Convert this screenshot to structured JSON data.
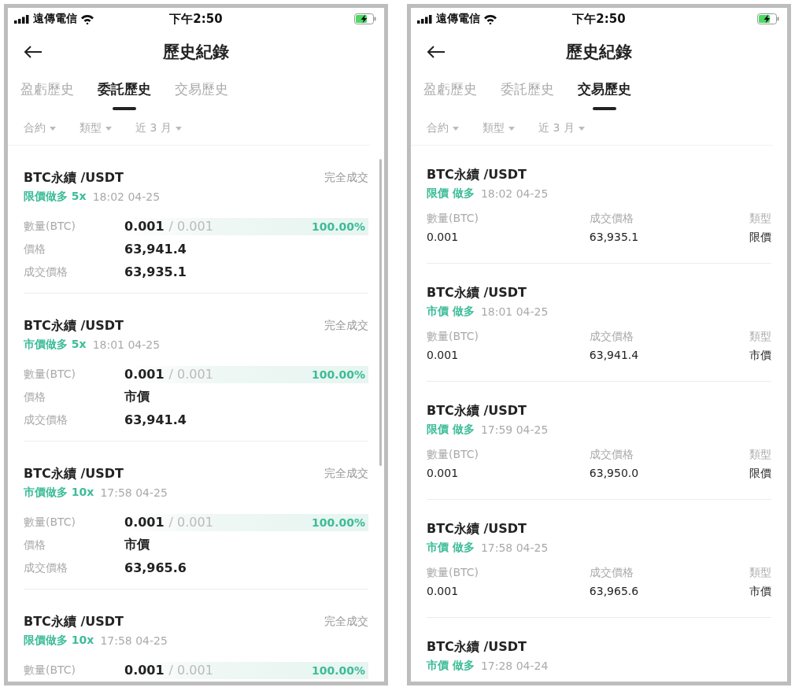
{
  "screens": [
    {
      "status_bar": {
        "carrier": "遠傳電信",
        "time": "下午2:50"
      },
      "title": "歷史紀錄",
      "tabs": [
        {
          "label": "盈虧歷史",
          "selected": false
        },
        {
          "label": "委託歷史",
          "selected": true
        },
        {
          "label": "交易歷史",
          "selected": false
        }
      ],
      "filters": [
        "合約",
        "類型",
        "近 3 月"
      ],
      "cards": [
        {
          "kind": "order",
          "pair": "BTC永續 /USDT",
          "status": "完全成交",
          "side": "限價做多 5x",
          "time": "18:02 04-25",
          "quantity": {
            "label": "數量(BTC)",
            "filled": "0.001",
            "total": "/ 0.001",
            "percent": "100.00%"
          },
          "fields": [
            {
              "label": "價格",
              "value": "63,941.4"
            },
            {
              "label": "成交價格",
              "value": "63,935.1"
            }
          ]
        },
        {
          "kind": "order",
          "pair": "BTC永續 /USDT",
          "status": "完全成交",
          "side": "市價做多 5x",
          "time": "18:01 04-25",
          "quantity": {
            "label": "數量(BTC)",
            "filled": "0.001",
            "total": "/ 0.001",
            "percent": "100.00%"
          },
          "fields": [
            {
              "label": "價格",
              "value": "市價"
            },
            {
              "label": "成交價格",
              "value": "63,941.4"
            }
          ]
        },
        {
          "kind": "order",
          "pair": "BTC永續 /USDT",
          "status": "完全成交",
          "side": "市價做多 10x",
          "time": "17:58 04-25",
          "quantity": {
            "label": "數量(BTC)",
            "filled": "0.001",
            "total": "/ 0.001",
            "percent": "100.00%"
          },
          "fields": [
            {
              "label": "價格",
              "value": "市價"
            },
            {
              "label": "成交價格",
              "value": "63,965.6"
            }
          ]
        },
        {
          "kind": "order",
          "pair": "BTC永續 /USDT",
          "status": "完全成交",
          "side": "限價做多 10x",
          "time": "17:58 04-25",
          "quantity": {
            "label": "數量(BTC)",
            "filled": "0.001",
            "total": "/ 0.001",
            "percent": "100.00%"
          }
        }
      ]
    },
    {
      "status_bar": {
        "carrier": "遠傳電信",
        "time": "下午2:50"
      },
      "title": "歷史紀錄",
      "tabs": [
        {
          "label": "盈虧歷史",
          "selected": false
        },
        {
          "label": "委託歷史",
          "selected": false
        },
        {
          "label": "交易歷史",
          "selected": true
        }
      ],
      "filters": [
        "合約",
        "類型",
        "近 3 月"
      ],
      "cards": [
        {
          "kind": "trade",
          "pair": "BTC永續 /USDT",
          "side": "限價 做多",
          "time": "18:02 04-25",
          "columns": [
            {
              "label": "數量(BTC)",
              "value": "0.001"
            },
            {
              "label": "成交價格",
              "value": "63,935.1"
            },
            {
              "label": "類型",
              "value": "限價"
            }
          ]
        },
        {
          "kind": "trade",
          "pair": "BTC永續 /USDT",
          "side": "市價 做多",
          "time": "18:01 04-25",
          "columns": [
            {
              "label": "數量(BTC)",
              "value": "0.001"
            },
            {
              "label": "成交價格",
              "value": "63,941.4"
            },
            {
              "label": "類型",
              "value": "市價"
            }
          ]
        },
        {
          "kind": "trade",
          "pair": "BTC永續 /USDT",
          "side": "限價 做多",
          "time": "17:59 04-25",
          "columns": [
            {
              "label": "數量(BTC)",
              "value": "0.001"
            },
            {
              "label": "成交價格",
              "value": "63,950.0"
            },
            {
              "label": "類型",
              "value": "限價"
            }
          ]
        },
        {
          "kind": "trade",
          "pair": "BTC永續 /USDT",
          "side": "市價 做多",
          "time": "17:58 04-25",
          "columns": [
            {
              "label": "數量(BTC)",
              "value": "0.001"
            },
            {
              "label": "成交價格",
              "value": "63,965.6"
            },
            {
              "label": "類型",
              "value": "市價"
            }
          ]
        },
        {
          "kind": "trade",
          "pair": "BTC永續 /USDT",
          "side": "市價 做多",
          "time": "17:28 04-24"
        }
      ]
    }
  ]
}
